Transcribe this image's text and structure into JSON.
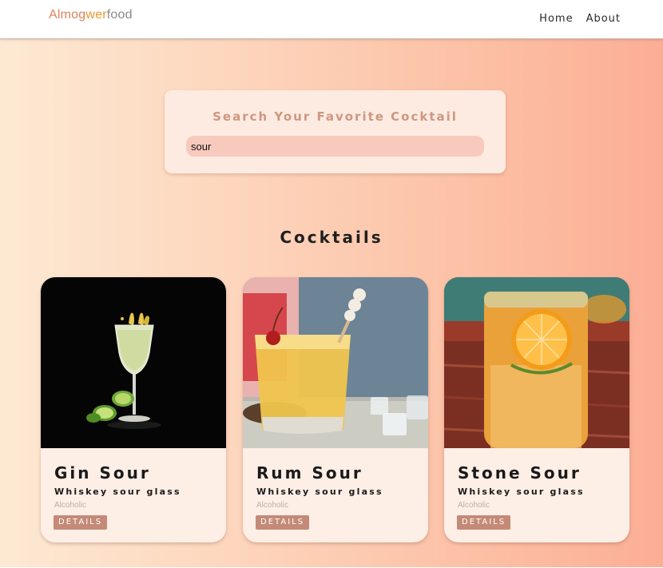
{
  "navbar": {
    "logo_part1": "Almog",
    "logo_part2": "wer",
    "logo_part3": "food",
    "links": [
      {
        "label": "Home"
      },
      {
        "label": "About"
      }
    ]
  },
  "search": {
    "title": "Search Your Favorite Cocktail",
    "value": "sour"
  },
  "section": {
    "title": "Cocktails"
  },
  "cocktails": [
    {
      "name": "Gin Sour",
      "glass": "Whiskey sour glass",
      "alcoholic": "Alcoholic",
      "details_label": "DETAILS"
    },
    {
      "name": "Rum Sour",
      "glass": "Whiskey sour glass",
      "alcoholic": "Alcoholic",
      "details_label": "DETAILS"
    },
    {
      "name": "Stone Sour",
      "glass": "Whiskey sour glass",
      "alcoholic": "Alcoholic",
      "details_label": "DETAILS"
    }
  ],
  "colors": {
    "accent": "#c48a77",
    "search_title": "#cf9680",
    "card_bg": "#fdeee6",
    "input_bg": "#f7cabd"
  }
}
